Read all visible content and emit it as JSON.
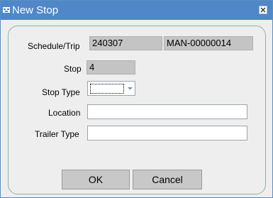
{
  "window": {
    "title": "New Stop",
    "close_icon": "close-icon",
    "app_icon": "form-icon"
  },
  "form": {
    "schedule_trip_label": "Schedule/Trip",
    "schedule_value": "240307",
    "trip_value": "MAN-00000014",
    "stop_label": "Stop",
    "stop_value": "4",
    "stop_type_label": "Stop Type",
    "stop_type_value": "",
    "location_label": "Location",
    "location_value": "",
    "trailer_type_label": "Trailer Type",
    "trailer_type_value": ""
  },
  "buttons": {
    "ok_label": "OK",
    "cancel_label": "Cancel"
  }
}
